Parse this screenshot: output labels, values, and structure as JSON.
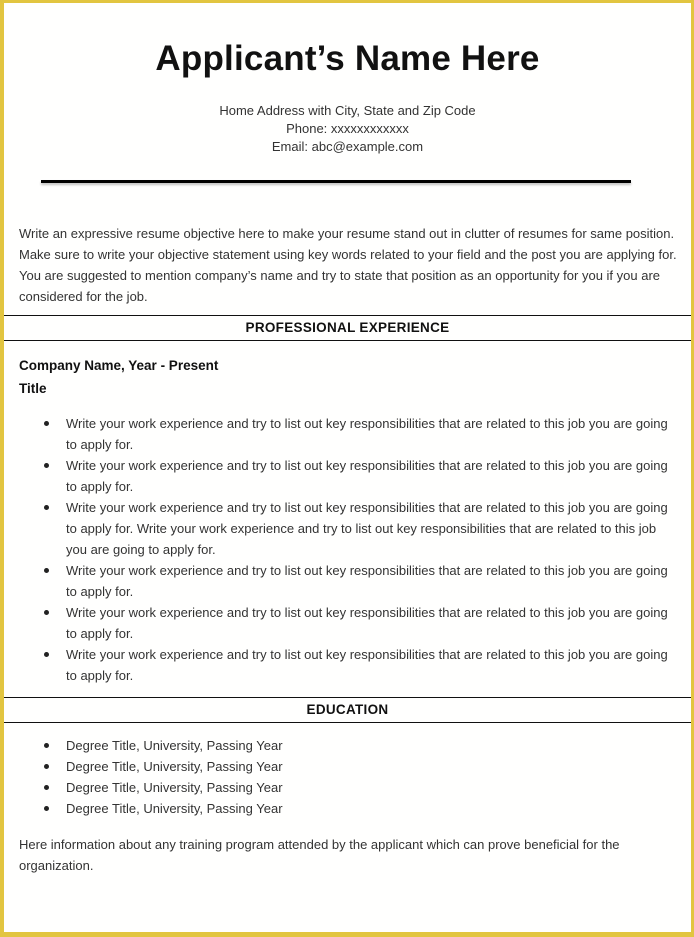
{
  "header": {
    "name": "Applicant’s Name Here",
    "address": "Home Address with City, State and Zip Code",
    "phone": "Phone: xxxxxxxxxxxx",
    "email": "Email: abc@example.com"
  },
  "objective": "Write an expressive resume objective here to make your resume stand out in clutter of resumes for same position. Make sure to write your objective statement using key words related to your field and the post you are applying for. You are suggested to mention company’s name and try to state that position as an opportunity for you if you are considered for the job.",
  "experience": {
    "heading": "PROFESSIONAL EXPERIENCE",
    "company": "Company Name, Year - Present",
    "title": "Title",
    "bullets": [
      "Write your work experience and try to list out key responsibilities that are related to this job you are going to apply for.",
      "Write your work experience and try to list out key responsibilities that are related to this job you are going to apply for.",
      "Write your work experience and try to list out key responsibilities that are related to this job you are going to apply for. Write your work experience and try to list out key responsibilities that are related to this job you are going to apply for.",
      "Write your work experience and try to list out key responsibilities that are related to this job you are going to apply for.",
      "Write your work experience and try to list out key responsibilities that are related to this job you are going to apply for.",
      "Write your work experience and try to list out key responsibilities that are related to this job you are going to apply for."
    ]
  },
  "education": {
    "heading": "EDUCATION",
    "items": [
      "Degree Title, University, Passing Year",
      "Degree Title, University, Passing Year",
      "Degree Title, University, Passing Year",
      "Degree Title, University, Passing Year"
    ],
    "training": "Here information about any training program attended by the applicant which can prove beneficial for the organization."
  },
  "colors": {
    "frame": "#e2c540",
    "rule": "#000000"
  }
}
